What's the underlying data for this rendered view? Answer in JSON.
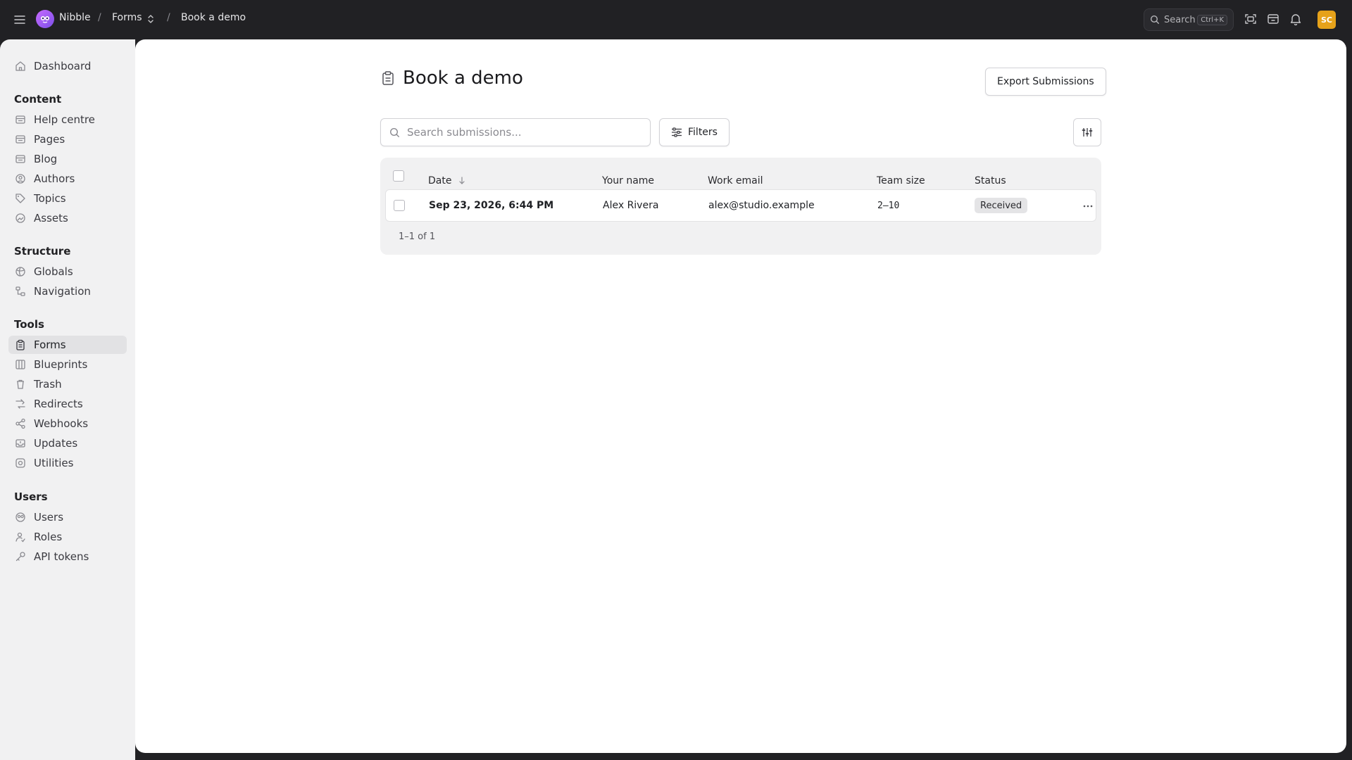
{
  "topbar": {
    "site_name": "Nibble",
    "breadcrumb_separator": "/",
    "breadcrumb_section": "Forms",
    "breadcrumb_current": "Book a demo",
    "search_label": "Search",
    "search_shortcut": "Ctrl+K",
    "avatar_initials": "SC",
    "avatar_color": "#e6a21a"
  },
  "sidebar": {
    "dashboard": "Dashboard",
    "groups": {
      "content": {
        "title": "Content",
        "items": [
          "Help centre",
          "Pages",
          "Blog",
          "Authors",
          "Topics",
          "Assets"
        ]
      },
      "structure": {
        "title": "Structure",
        "items": [
          "Globals",
          "Navigation"
        ]
      },
      "tools": {
        "title": "Tools",
        "items": [
          "Forms",
          "Blueprints",
          "Trash",
          "Redirects",
          "Webhooks",
          "Updates",
          "Utilities"
        ]
      },
      "users": {
        "title": "Users",
        "items": [
          "Users",
          "Roles",
          "API tokens"
        ]
      }
    },
    "active_item": "Forms"
  },
  "main": {
    "title": "Book a demo",
    "export_label": "Export Submissions",
    "search_placeholder": "Search submissions...",
    "filters_label": "Filters",
    "table": {
      "columns": [
        "Date",
        "Your name",
        "Work email",
        "Team size",
        "Status"
      ],
      "sorted_by": "Date",
      "sort_direction": "descending",
      "rows": [
        {
          "date": "Sep 23, 2026, 6:44 PM",
          "name": "Alex Rivera",
          "email": "alex@studio.example",
          "team_size": "2–10",
          "status": "Received"
        }
      ],
      "pagination": "1–1 of 1"
    }
  }
}
